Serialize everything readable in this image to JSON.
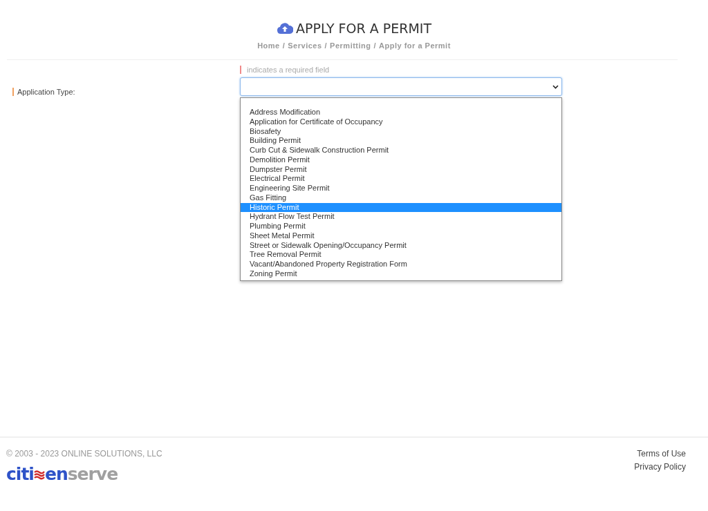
{
  "header": {
    "title": "APPLY FOR A PERMIT",
    "breadcrumb": [
      "Home",
      "Services",
      "Permitting",
      "Apply for a Permit"
    ],
    "breadcrumb_separator": "/"
  },
  "form": {
    "required_note": "indicates a required field",
    "field_label": "Application Type:",
    "select": {
      "expanded": true,
      "options": [
        {
          "label": "Address Modification",
          "selected": false
        },
        {
          "label": "Application for Certificate of Occupancy",
          "selected": false
        },
        {
          "label": "Biosafety",
          "selected": false
        },
        {
          "label": "Building Permit",
          "selected": false
        },
        {
          "label": "Curb Cut & Sidewalk Construction Permit",
          "selected": false
        },
        {
          "label": "Demolition Permit",
          "selected": false
        },
        {
          "label": "Dumpster Permit",
          "selected": false
        },
        {
          "label": "Electrical Permit",
          "selected": false
        },
        {
          "label": "Engineering Site Permit",
          "selected": false
        },
        {
          "label": "Gas Fitting",
          "selected": false
        },
        {
          "label": "Historic Permit",
          "selected": true
        },
        {
          "label": "Hydrant Flow Test Permit",
          "selected": false
        },
        {
          "label": "Plumbing Permit",
          "selected": false
        },
        {
          "label": "Sheet Metal Permit",
          "selected": false
        },
        {
          "label": "Street or Sidewalk Opening/Occupancy Permit",
          "selected": false
        },
        {
          "label": "Tree Removal Permit",
          "selected": false
        },
        {
          "label": "Vacant/Abandoned Property Registration Form",
          "selected": false
        },
        {
          "label": "Zoning Permit",
          "selected": false
        }
      ]
    }
  },
  "footer": {
    "copyright": "© 2003 - 2023 ONLINE SOLUTIONS, LLC",
    "logo": {
      "part_1": "citi",
      "part_2": "en",
      "part_3": "serve"
    },
    "links": [
      "Terms of Use",
      "Privacy Policy"
    ]
  }
}
